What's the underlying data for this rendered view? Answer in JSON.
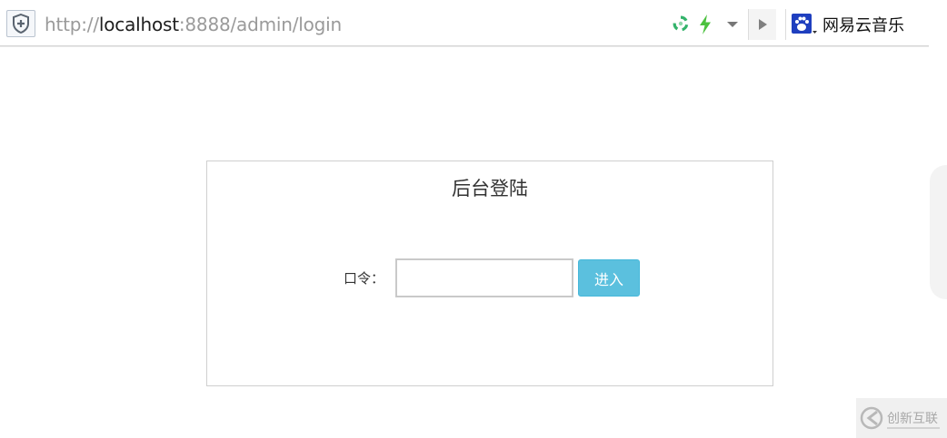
{
  "browser": {
    "url_scheme": "http://",
    "url_host": "localhost",
    "url_rest": ":8888/admin/login",
    "search_engine_label": "网易云音乐"
  },
  "login": {
    "title": "后台登陆",
    "password_label": "口令：",
    "password_value": "",
    "submit_label": "进入"
  },
  "watermark": {
    "text": "创新互联"
  },
  "colors": {
    "accent_button": "#5bc0de",
    "border": "#cfcfcf",
    "bolt": "#4cc13f",
    "recycle": "#33b36a"
  },
  "icons": {
    "security": "shield-plus-icon",
    "refresh": "recycle-icon",
    "speed": "lightning-icon",
    "dropdown": "chevron-down-icon",
    "go": "play-icon",
    "engine": "paw-icon",
    "watermark_logo": "watermark-logo-icon"
  }
}
